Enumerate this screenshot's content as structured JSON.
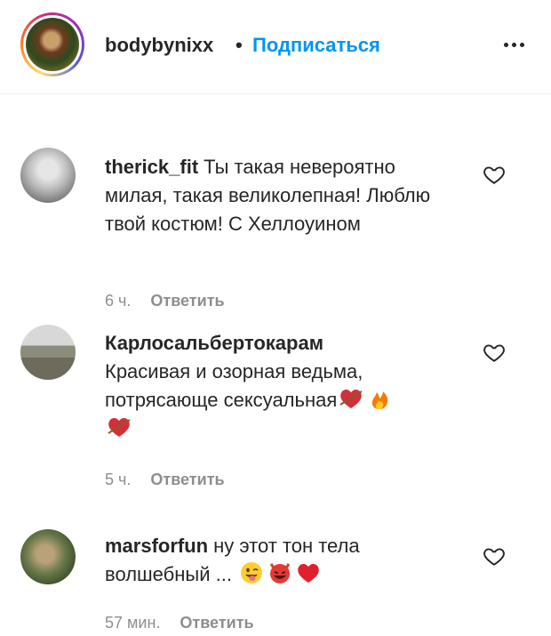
{
  "post": {
    "username": "bodybynixx",
    "dot": "•",
    "follow_label": "Подписаться"
  },
  "comments": [
    {
      "username": "therick_fit",
      "text": "Ты такая невероятно милая, такая великолепная! Люблю твой костюм! С Хеллоуином",
      "time": "6 ч.",
      "reply_label": "Ответить",
      "emojis": []
    },
    {
      "username": "Карлосальбертокарам",
      "text": "Красивая и озорная ведьма, потрясающе сексуальная",
      "time": "5 ч.",
      "reply_label": "Ответить",
      "emojis": [
        "heart-with-arrow-emoji",
        "fire-emoji",
        "heart-with-arrow-emoji"
      ]
    },
    {
      "username": "marsforfun",
      "text": "ну этот тон тела волшебный ...",
      "time": "57 мин.",
      "reply_label": "Ответить",
      "emojis": [
        "tongue-wink-emoji",
        "smiling-devil-emoji",
        "red-heart-emoji"
      ]
    }
  ],
  "icons": {
    "more": "more-horizontal-icon",
    "like": "heart-outline-icon"
  },
  "colors": {
    "link_blue": "#0095f6",
    "text": "#262626",
    "secondary": "#8e8e8e"
  }
}
